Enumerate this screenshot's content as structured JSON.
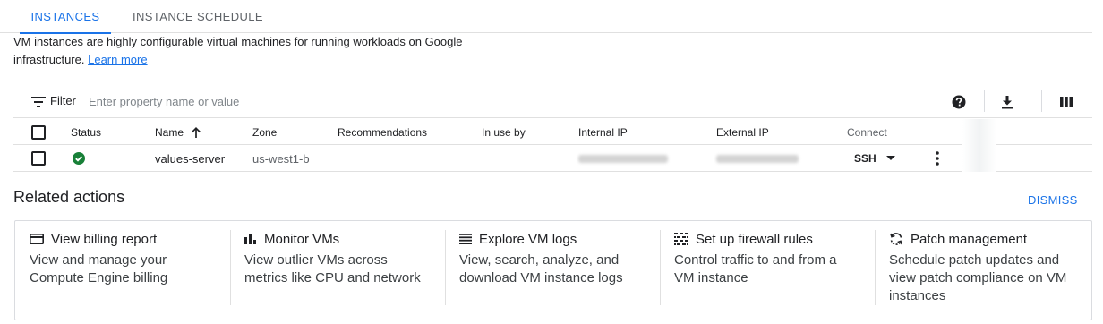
{
  "tabs": [
    {
      "label": "INSTANCES",
      "active": true
    },
    {
      "label": "INSTANCE SCHEDULE",
      "active": false
    }
  ],
  "description": {
    "text": "VM instances are highly configurable virtual machines for running workloads on Google infrastructure.",
    "link": "Learn more"
  },
  "filter": {
    "label": "Filter",
    "placeholder": "Enter property name or value",
    "icons": [
      "filter-icon",
      "help-icon",
      "download-icon",
      "columns-icon"
    ]
  },
  "table": {
    "columns": [
      "Status",
      "Name",
      "Zone",
      "Recommendations",
      "In use by",
      "Internal IP",
      "External IP",
      "Connect"
    ],
    "sort_column": "Name",
    "sort_direction": "ascending",
    "rows": [
      {
        "status": "running",
        "name": "values-server",
        "zone": "us-west1-b",
        "recommendations": "",
        "in_use_by": "",
        "internal_ip": "(redacted)",
        "external_ip": "(redacted)",
        "connect": "SSH"
      }
    ]
  },
  "related": {
    "title": "Related actions",
    "dismiss": "DISMISS",
    "cards": [
      {
        "icon": "billing-card-icon",
        "title": "View billing report",
        "desc": "View and manage your Compute Engine billing"
      },
      {
        "icon": "bar-chart-icon",
        "title": "Monitor VMs",
        "desc": "View outlier VMs across metrics like CPU and network"
      },
      {
        "icon": "logs-list-icon",
        "title": "Explore VM logs",
        "desc": "View, search, analyze, and download VM instance logs"
      },
      {
        "icon": "firewall-icon",
        "title": "Set up firewall rules",
        "desc": "Control traffic to and from a VM instance"
      },
      {
        "icon": "patch-sync-icon",
        "title": "Patch management",
        "desc": "Schedule patch updates and view patch compliance on VM instances"
      }
    ]
  },
  "colors": {
    "accent": "#1a73e8",
    "status_ok": "#188038",
    "divider": "#e0e0e0"
  }
}
